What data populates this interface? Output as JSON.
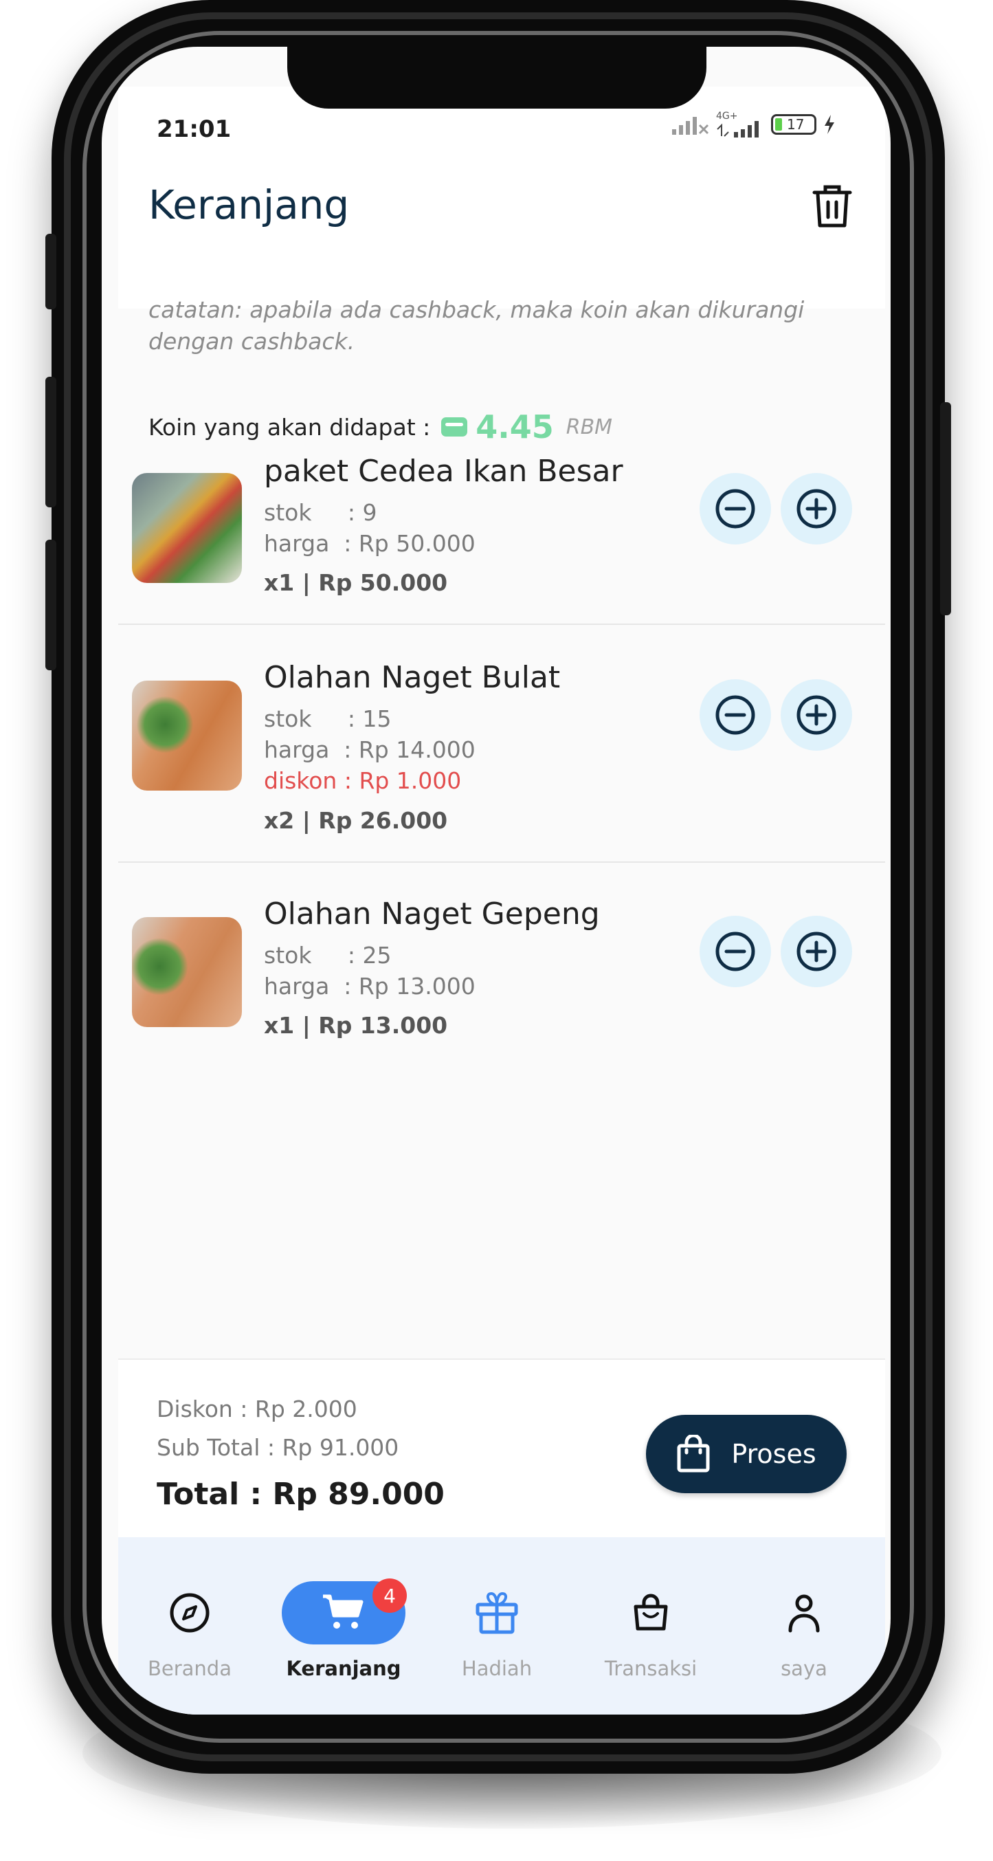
{
  "status": {
    "time": "21:01",
    "battery": "17",
    "network": "4G+"
  },
  "header": {
    "title": "Keranjang"
  },
  "note": "catatan: apabila ada cashback, maka koin akan dikurangi dengan cashback.",
  "coins": {
    "label": "Koin yang akan didapat :",
    "value": "4.45",
    "unit": "RBM"
  },
  "items": [
    {
      "name": "paket Cedea Ikan Besar",
      "stock": "stok     : 9",
      "price": "harga  : Rp 50.000",
      "line_total": "x1 | Rp 50.000"
    },
    {
      "name": "Olahan Naget Bulat",
      "stock": "stok     : 15",
      "price": "harga  : Rp 14.000",
      "discount": "diskon : Rp 1.000",
      "line_total": "x2 | Rp 26.000"
    },
    {
      "name": "Olahan Naget Gepeng",
      "stock": "stok     : 25",
      "price": "harga  : Rp 13.000",
      "line_total": "x1 | Rp 13.000"
    }
  ],
  "summary": {
    "discount": "Diskon : Rp 2.000",
    "subtotal": "Sub Total : Rp 91.000",
    "total": "Total : Rp 89.000",
    "process_label": "Proses"
  },
  "nav": {
    "items": [
      {
        "label": "Beranda",
        "icon": "compass-icon"
      },
      {
        "label": "Keranjang",
        "icon": "cart-icon",
        "badge": "4",
        "active": true
      },
      {
        "label": "Hadiah",
        "icon": "gift-icon"
      },
      {
        "label": "Transaksi",
        "icon": "shopping-bag-icon"
      },
      {
        "label": "saya",
        "icon": "person-icon"
      }
    ]
  },
  "colors": {
    "primary_dark": "#0e2c45",
    "accent_blue": "#3d87f0",
    "coin_green": "#78d9a2",
    "discount_red": "#e24d4d",
    "circle_bg": "#dff2fb"
  }
}
